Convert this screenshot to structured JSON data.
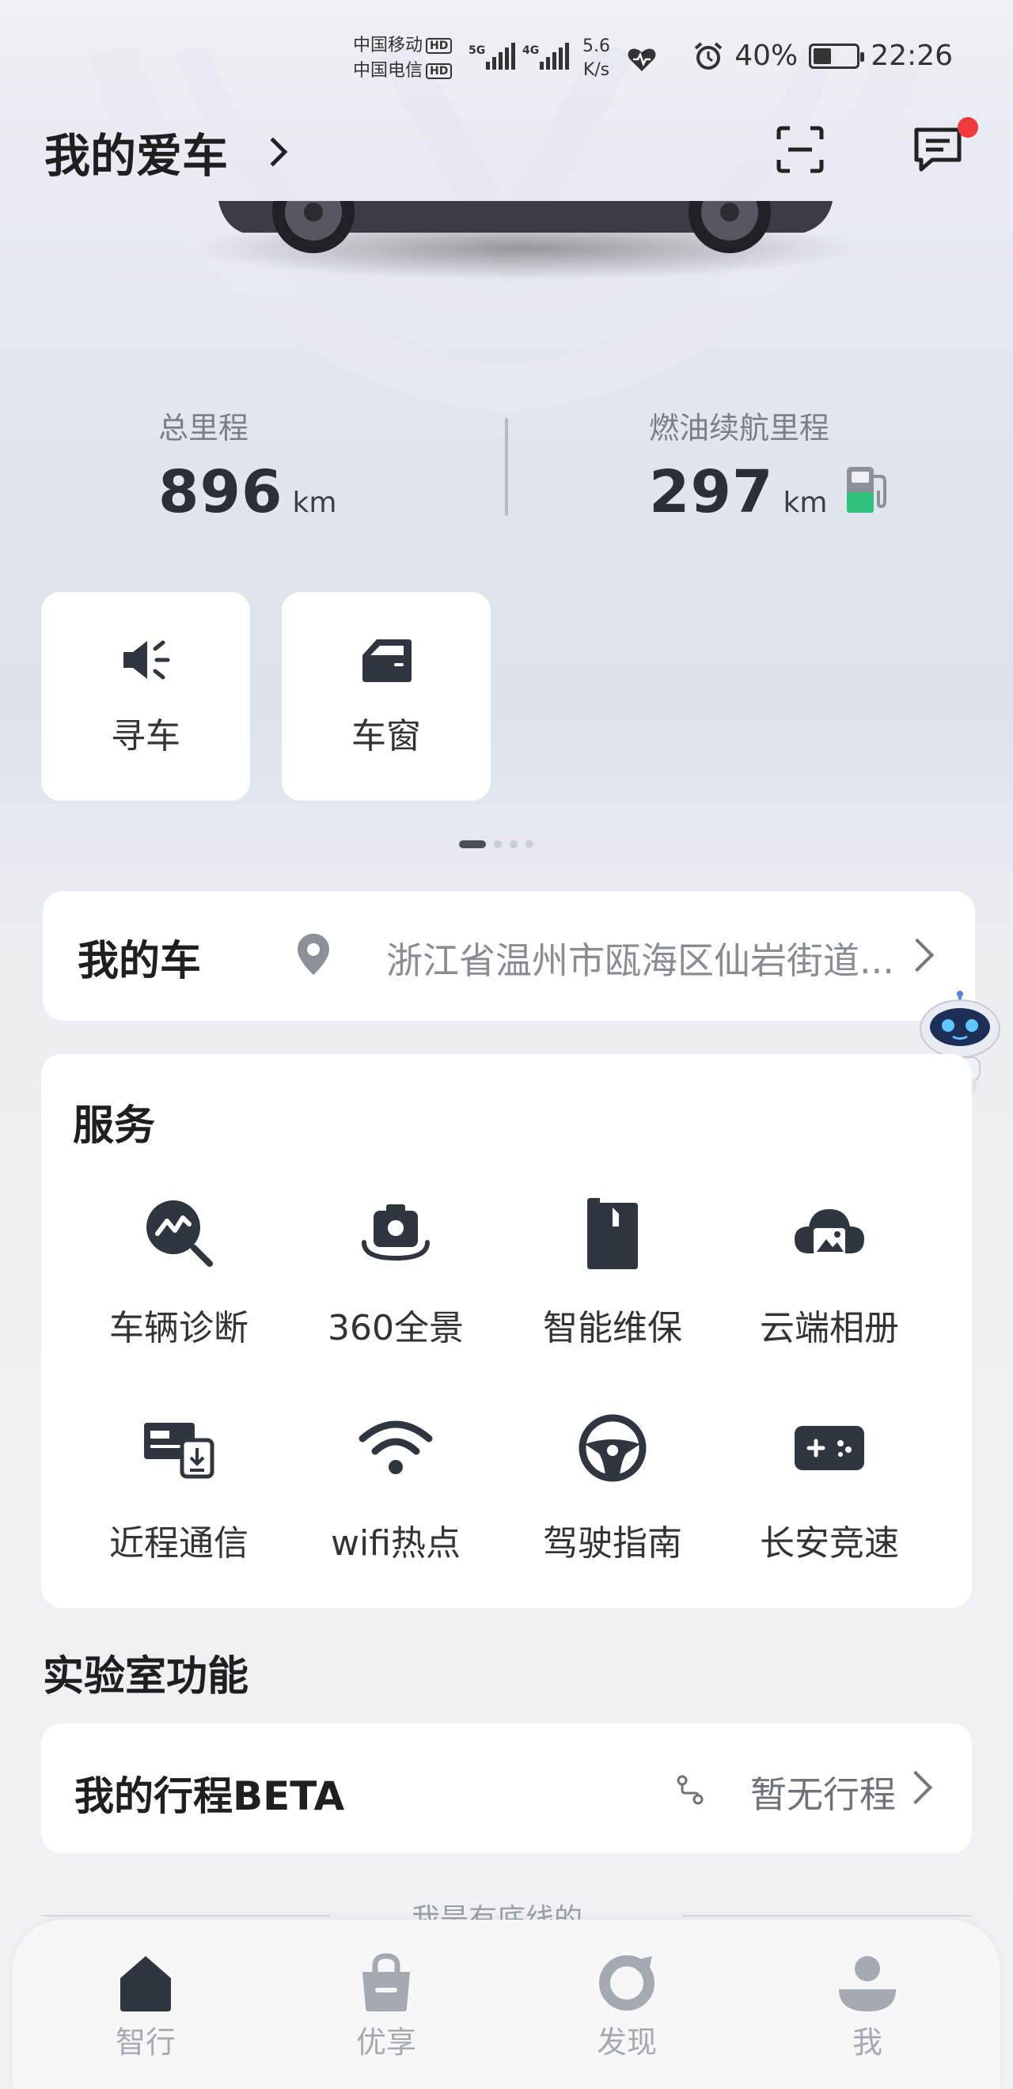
{
  "status_bar": {
    "carrier1": "中国移动",
    "carrier2": "中国电信",
    "hd": "HD",
    "net1": "5G",
    "net2": "4G",
    "speed_value": "5.6",
    "speed_unit": "K/s",
    "battery": "40%",
    "time": "22:26"
  },
  "header": {
    "title": "我的爱车"
  },
  "stats": {
    "mileage_label": "总里程",
    "mileage_value": "896",
    "mileage_unit": "km",
    "range_label": "燃油续航里程",
    "range_value": "297",
    "range_unit": "km"
  },
  "quick_actions": [
    {
      "label": "寻车",
      "icon": "speaker-icon"
    },
    {
      "label": "车窗",
      "icon": "car-window-icon"
    }
  ],
  "my_car": {
    "title": "我的车",
    "location": "浙江省温州市瓯海区仙岩街道..."
  },
  "services": {
    "title": "服务",
    "items": [
      {
        "label": "车辆诊断",
        "icon": "diagnosis-icon"
      },
      {
        "label": "360全景",
        "icon": "camera-360-icon"
      },
      {
        "label": "智能维保",
        "icon": "maintenance-icon"
      },
      {
        "label": "云端相册",
        "icon": "cloud-album-icon"
      },
      {
        "label": "近程通信",
        "icon": "near-comm-icon"
      },
      {
        "label": "wifi热点",
        "icon": "wifi-icon"
      },
      {
        "label": "驾驶指南",
        "icon": "steering-wheel-icon"
      },
      {
        "label": "长安竞速",
        "icon": "gamepad-icon"
      }
    ]
  },
  "lab": {
    "title": "实验室功能",
    "trip_title": "我的行程BETA",
    "trip_status": "暂无行程"
  },
  "footer_note": "我是有底线的",
  "tabs": [
    {
      "label": "智行",
      "icon": "home-icon",
      "active": true
    },
    {
      "label": "优享",
      "icon": "shopping-bag-icon",
      "active": false
    },
    {
      "label": "发现",
      "icon": "discover-icon",
      "active": false
    },
    {
      "label": "我",
      "icon": "profile-icon",
      "active": false
    }
  ],
  "colors": {
    "accent_dark": "#2f3640",
    "fuel_green": "#2ec27e",
    "badge_red": "#f23a3c"
  }
}
